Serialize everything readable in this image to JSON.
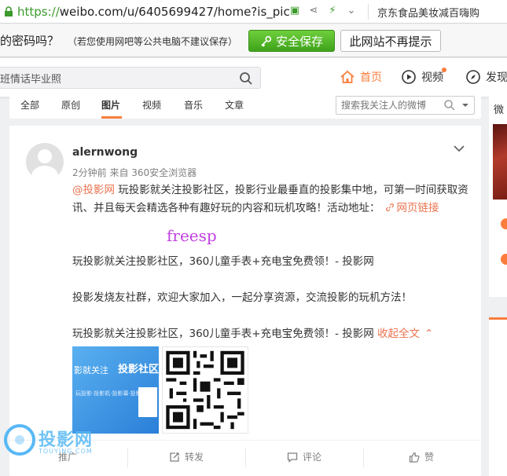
{
  "browser": {
    "url_scheme": "https://",
    "url_rest": "weibo.com/u/6405699427/home?is_pic",
    "ad_text": "京东食品美妆减百嗨购"
  },
  "password_bar": {
    "question": "的密码吗？",
    "hint": "（若您使用网吧等公共电脑不建议保存）",
    "save_label": "安全保存",
    "never_label": "此网站不再提示"
  },
  "topnav": {
    "search_value": "班情话毕业照",
    "home_label": "首页",
    "video_label": "视频",
    "discover_label": "发现"
  },
  "tabs": {
    "items": [
      "全部",
      "原创",
      "图片",
      "视频",
      "音乐",
      "文章"
    ],
    "active": "图片",
    "search_placeholder": "搜索我关注人的微博"
  },
  "post": {
    "username": "alernwong",
    "meta": "2分钟前 来自 360安全浏览器",
    "mention": "@投影网",
    "body1": " 玩投影就关注投影社区，投影行业最垂直的投影集中地，可第一时间获取资讯、并且每天会精选各种有趣好玩的内容和玩机攻略！活动地址：",
    "link_label": "网页链接",
    "overlay_text": "freesp",
    "para2": "玩投影就关注投影社区，360儿童手表+充电宝免费领！- 投影网",
    "para3": "投影发烧友社群，欢迎大家加入，一起分享资源，交流投影的玩机方法！",
    "para4": "玩投影就关注投影社区，360儿童手表+充电宝免费领！- 投影网",
    "collapse_label": "收起全文",
    "pic1_text": "影就关注",
    "pic1_bold": "投影社区",
    "pic1_small": "玩投影·投影机·投影幕·投影器"
  },
  "actions": {
    "promote": "推广",
    "repost": "转发",
    "comment": "评论",
    "like": "赞"
  },
  "watermark": {
    "text": "投影网",
    "sub": "TOUYING.COM"
  },
  "sidebar": {
    "glyph": "微"
  },
  "colors": {
    "accent": "#fa7d3c",
    "link": "#eb7350",
    "save_green": "#4cb82a",
    "overlay_purple": "#c040e0"
  }
}
